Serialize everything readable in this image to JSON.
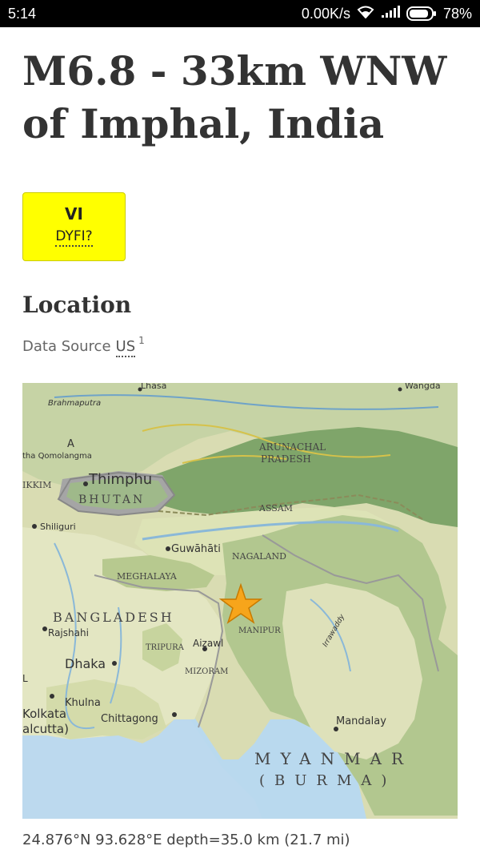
{
  "status_bar": {
    "time": "5:14",
    "network_speed": "0.00K/s",
    "battery": "78%",
    "icons": [
      "wifi-icon",
      "signal-icon",
      "battery-icon"
    ]
  },
  "event": {
    "title": "M6.8 - 33km WNW of Imphal, India"
  },
  "intensity": {
    "value": "VI",
    "label": "DYFI?",
    "color": "#ffff00"
  },
  "location": {
    "heading": "Location",
    "data_source_label": "Data Source",
    "data_source_value": "US",
    "data_source_note": "1",
    "coordinates": "24.876°N 93.628°E depth=35.0 km (21.7 mi)"
  },
  "map": {
    "marker": "star-icon",
    "labels": {
      "lhasa": "Lhasa",
      "wangda": "Wangda",
      "brahmaputra": "Brahmaputra",
      "a": "A",
      "qomolangma": "tha Qomolangma",
      "arunachal": "ARUNACHAL",
      "pradesh": "PRADESH",
      "sikkim": "IKKIM",
      "thimphu": "Thimphu",
      "bhutan": "BHUTAN",
      "assam": "ASSAM",
      "shiliguri": "Shiliguri",
      "guwahati": "Guwāhāti",
      "nagaland": "NAGALAND",
      "meghalaya": "MEGHALAYA",
      "bangladesh": "BANGLADESH",
      "manipur": "MANIPUR",
      "rajshahi": "Rajshahi",
      "tripura": "TRIPURA",
      "aizawl": "Aizawl",
      "dhaka": "Dhaka",
      "mizoram": "MIZORAM",
      "l": "L",
      "khulna": "Khulna",
      "kolkata": "Kolkata",
      "calcutta": "alcutta)",
      "chittagong": "Chittagong",
      "mandalay": "Mandalay",
      "irrawaddy": "Irrawaddy",
      "myanmar": "MYANMAR",
      "burma": "(BURMA)"
    }
  }
}
